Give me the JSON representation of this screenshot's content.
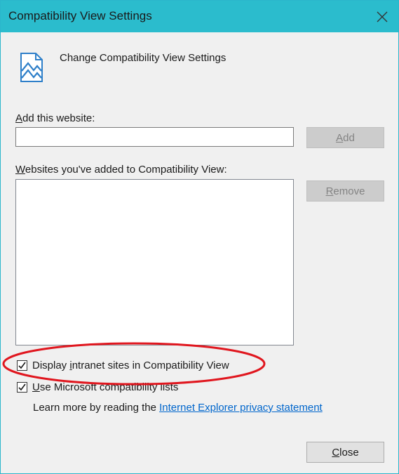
{
  "window": {
    "title": "Compatibility View Settings"
  },
  "header": {
    "text": "Change Compatibility View Settings",
    "icon": "compatibility-view-icon"
  },
  "add_website": {
    "label_accesskey": "A",
    "label_rest": "dd this website:",
    "input_value": "",
    "button_accesskey": "A",
    "button_rest": "dd"
  },
  "websites_list": {
    "label_accesskey": "W",
    "label_rest": "ebsites you've added to Compatibility View:",
    "items": [],
    "remove_accesskey": "R",
    "remove_rest": "emove"
  },
  "options": {
    "intranet": {
      "label_before": "Display ",
      "label_accesskey": "i",
      "label_after": "ntranet sites in Compatibility View",
      "checked": true
    },
    "ms_lists": {
      "label_accesskey": "U",
      "label_after": "se Microsoft compatibility lists",
      "checked": true
    }
  },
  "learn_more": {
    "text": "Learn more by reading the ",
    "link_text": "Internet Explorer privacy statement"
  },
  "close_button": {
    "accesskey": "C",
    "rest": "lose"
  },
  "annotation": {
    "ellipse_color": "#e0161e"
  }
}
